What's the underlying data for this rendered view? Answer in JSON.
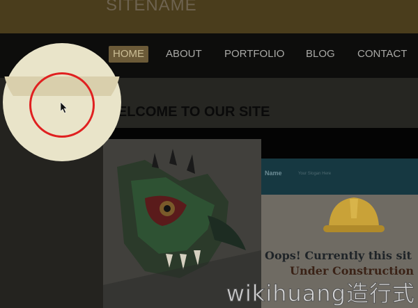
{
  "site": {
    "name": "SITENAME",
    "welcome": "WELCOME TO OUR SITE"
  },
  "nav": {
    "items": [
      {
        "label": "HOME",
        "active": true
      },
      {
        "label": "ABOUT",
        "active": false
      },
      {
        "label": "PORTFOLIO",
        "active": false
      },
      {
        "label": "BLOG",
        "active": false
      },
      {
        "label": "CONTACT",
        "active": false
      }
    ]
  },
  "preview": {
    "thumb_name": "Name",
    "thumb_tagline": "Your Slogan Here",
    "under_construction_line1": "Oops! Currently this sit",
    "under_construction_line2": "Under Construction"
  },
  "watermark": "wikihuang造行式",
  "colors": {
    "header_band": "#4a3d1c",
    "nav_bar": "#0d0d0c",
    "active_nav": "#6b5a38",
    "highlight_circle": "#e9e4c9",
    "click_ring": "#e02020",
    "thumb_bar": "#163841"
  },
  "icons": {
    "cursor": "arrow-cursor-icon",
    "hardhat": "hardhat-icon"
  }
}
